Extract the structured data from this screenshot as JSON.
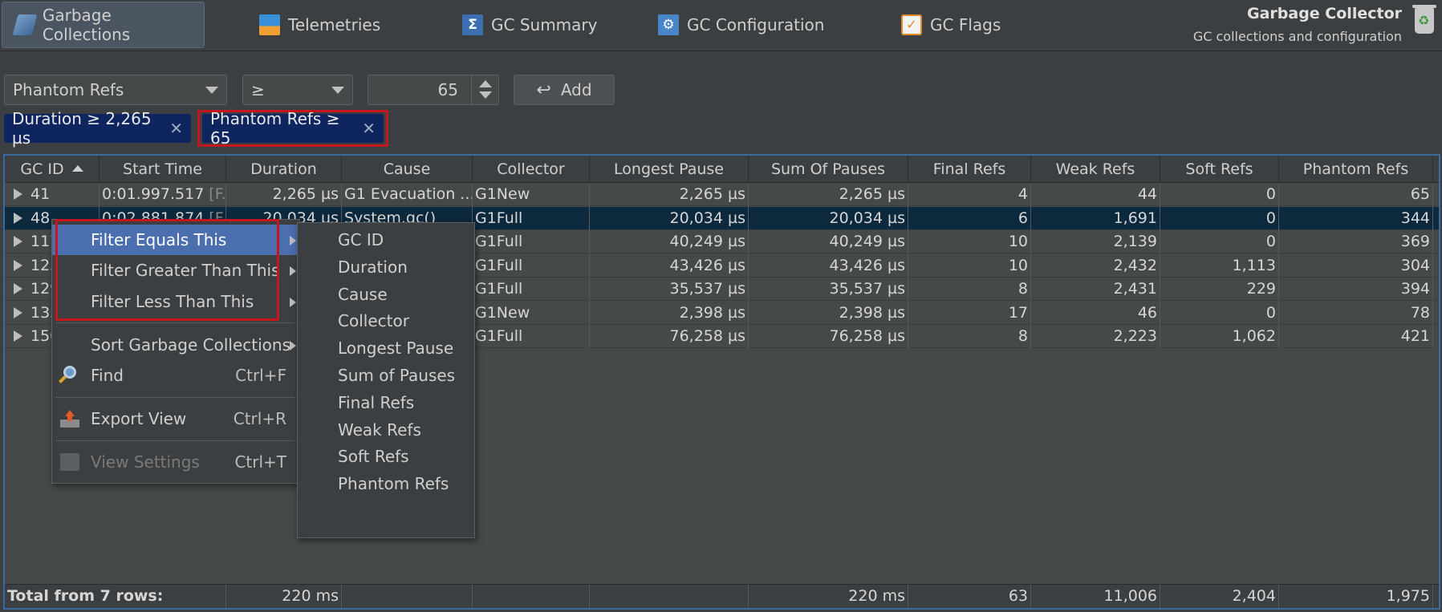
{
  "tabs": [
    {
      "label": "Garbage Collections",
      "icon": "gc-icon",
      "active": true
    },
    {
      "label": "Telemetries",
      "icon": "telemetry-icon",
      "active": false
    },
    {
      "label": "GC Summary",
      "icon": "summary-icon",
      "active": false
    },
    {
      "label": "GC Configuration",
      "icon": "configuration-icon",
      "active": false
    },
    {
      "label": "GC Flags",
      "icon": "flags-icon",
      "active": false
    }
  ],
  "header": {
    "title": "Garbage Collector",
    "subtitle": "GC collections and configuration"
  },
  "filter": {
    "field": "Phantom Refs",
    "operator": "≥",
    "value": "65",
    "add_label": "Add",
    "chips": [
      {
        "label": "Duration ≥ 2,265 µs",
        "close": "✕"
      },
      {
        "label": "Phantom Refs ≥ 65",
        "close": "✕"
      }
    ]
  },
  "table": {
    "columns": [
      "GC ID",
      "Start Time",
      "Duration",
      "Cause",
      "Collector",
      "Longest Pause",
      "Sum Of Pauses",
      "Final Refs",
      "Weak Refs",
      "Soft Refs",
      "Phantom Refs"
    ],
    "sort_column": "GC ID",
    "rows": [
      {
        "id": "41",
        "start": "0:01.997.517",
        "start_suffix": "[F...",
        "duration": "2,265 µs",
        "cause": "G1 Evacuation ...",
        "collector": "G1New",
        "longest": "2,265 µs",
        "sum": "2,265 µs",
        "final": "4",
        "weak": "44",
        "soft": "0",
        "phantom": "65"
      },
      {
        "id": "48",
        "start": "0:02.881.874",
        "start_suffix": "[F...",
        "duration": "20,034 µs",
        "cause": "System.gc()",
        "collector": "G1Full",
        "longest": "20,034 µs",
        "sum": "20,034 µs",
        "final": "6",
        "weak": "1,691",
        "soft": "0",
        "phantom": "344"
      },
      {
        "id": "117",
        "start": "",
        "start_suffix": "",
        "duration": "",
        "cause": "",
        "collector": "G1Full",
        "longest": "40,249 µs",
        "sum": "40,249 µs",
        "final": "10",
        "weak": "2,139",
        "soft": "0",
        "phantom": "369"
      },
      {
        "id": "123",
        "start": "",
        "start_suffix": "",
        "duration": "",
        "cause": "",
        "collector": "G1Full",
        "longest": "43,426 µs",
        "sum": "43,426 µs",
        "final": "10",
        "weak": "2,432",
        "soft": "1,113",
        "phantom": "304"
      },
      {
        "id": "129",
        "start": "",
        "start_suffix": "",
        "duration": "",
        "cause": "",
        "collector": "G1Full",
        "longest": "35,537 µs",
        "sum": "35,537 µs",
        "final": "8",
        "weak": "2,431",
        "soft": "229",
        "phantom": "394"
      },
      {
        "id": "135",
        "start": "",
        "start_suffix": "",
        "duration": "",
        "cause": "",
        "collector": "G1New",
        "longest": "2,398 µs",
        "sum": "2,398 µs",
        "final": "17",
        "weak": "46",
        "soft": "0",
        "phantom": "78"
      },
      {
        "id": "150",
        "start": "",
        "start_suffix": "",
        "duration": "",
        "cause": "",
        "collector": "G1Full",
        "longest": "76,258 µs",
        "sum": "76,258 µs",
        "final": "8",
        "weak": "2,223",
        "soft": "1,062",
        "phantom": "421"
      }
    ],
    "total": {
      "label": "Total from 7 rows:",
      "duration": "220 ms",
      "sum": "220 ms",
      "final": "63",
      "weak": "11,006",
      "soft": "2,404",
      "phantom": "1,975"
    }
  },
  "context_menu": {
    "items": [
      {
        "label": "Filter Equals This",
        "submenu": true,
        "highlighted": true
      },
      {
        "label": "Filter Greater Than This",
        "submenu": true
      },
      {
        "label": "Filter Less Than This",
        "submenu": true
      },
      {
        "label": "Sort Garbage Collections",
        "submenu": true
      },
      {
        "label": "Find",
        "shortcut": "Ctrl+F",
        "icon": "find-icon"
      },
      {
        "label": "Export View",
        "shortcut": "Ctrl+R",
        "icon": "export-icon"
      },
      {
        "label": "View Settings",
        "shortcut": "Ctrl+T",
        "icon": "settings-icon",
        "disabled": true
      }
    ]
  },
  "submenu": {
    "items": [
      "GC ID",
      "Duration",
      "Cause",
      "Collector",
      "Longest Pause",
      "Sum of Pauses",
      "Final Refs",
      "Weak Refs",
      "Soft Refs",
      "Phantom Refs"
    ]
  }
}
